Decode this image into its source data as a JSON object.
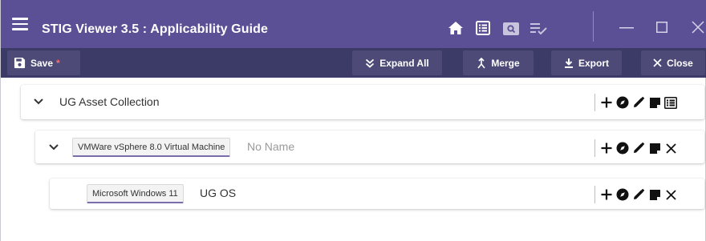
{
  "window": {
    "title": "STIG Viewer 3.5 : Applicability Guide",
    "icons": [
      "home-icon",
      "list-view-icon",
      "search-panel-icon",
      "playlist-check-icon",
      "minimize-icon",
      "maximize-icon",
      "close-window-icon"
    ]
  },
  "toolbar": {
    "save_label": "Save",
    "unsaved_marker": "*",
    "expand_all_label": "Expand All",
    "merge_label": "Merge",
    "export_label": "Export",
    "close_label": "Close"
  },
  "tree": {
    "collection": {
      "name": "UG Asset Collection"
    },
    "asset": {
      "type": "VMWare vSphere 8.0 Virtual Machine",
      "name": "No Name"
    },
    "component": {
      "type": "Microsoft Windows 11",
      "name": "UG OS"
    }
  },
  "colors": {
    "titlebar": "#5b4f95",
    "toolbar": "#3c3a66",
    "button": "#4d4a78",
    "unsaved": "#ff6d6d",
    "chip_underline": "#7b6cae"
  }
}
